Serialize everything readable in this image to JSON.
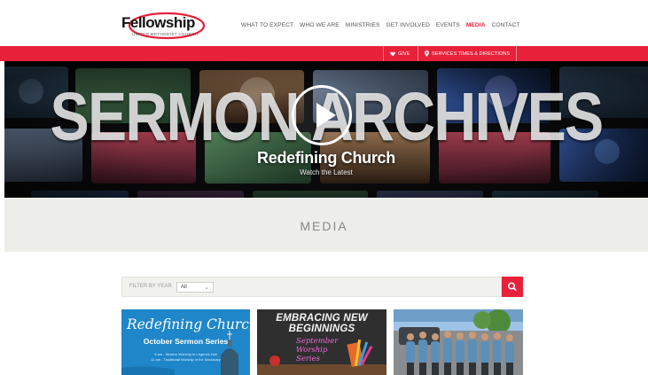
{
  "header": {
    "logo_text": "Fellowship",
    "logo_subtext": "UNITED METHODIST CHURCH",
    "nav": [
      {
        "label": "WHAT TO EXPECT"
      },
      {
        "label": "WHO WE ARE"
      },
      {
        "label": "MINISTRIES"
      },
      {
        "label": "GET INVOLVED"
      },
      {
        "label": "EVENTS"
      },
      {
        "label": "MEDIA"
      },
      {
        "label": "CONTACT"
      }
    ],
    "active_nav": "MEDIA"
  },
  "redbar": {
    "give_label": "GIVE",
    "give_icon": "heart-icon",
    "services_label": "SERVICES TIMES & DIRECTIONS",
    "services_icon": "location-pin-icon"
  },
  "hero": {
    "title": "SERMON ARCHIVES",
    "subtitle": "Redefining Church",
    "link_label": "Watch the Latest",
    "play_icon": "play-icon"
  },
  "section": {
    "title": "MEDIA"
  },
  "filter": {
    "label": "FILTER BY YEAR",
    "selected": "All",
    "search_icon": "search-icon"
  },
  "cards": [
    {
      "script_title": "Redefining Church",
      "series": "October Sermon Series",
      "line1": "9 am - Modern Worship in Legends Hall",
      "line2": "11 am - Traditional Worship in the Sanctuary"
    },
    {
      "title_line1": "EMBRACING NEW",
      "title_line2": "BEGINNINGS",
      "script_line1": "September",
      "script_line2": "Worship",
      "script_line3": "Series"
    },
    {
      "image_subject": "group-photo"
    }
  ],
  "colors": {
    "brand_red": "#e8203a",
    "card1_blue": "#1f86c9",
    "band_gray": "#ededea"
  }
}
